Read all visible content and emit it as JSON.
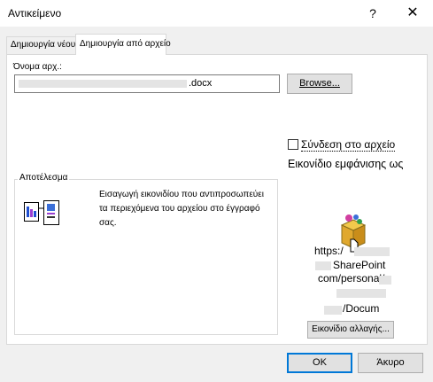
{
  "window": {
    "title": "Αντικείμενο",
    "help_glyph": "?",
    "close_glyph": "✕"
  },
  "tabs": [
    {
      "label": "Δημιουργία νέου",
      "active": false
    },
    {
      "label": "Δημιουργία από αρχείο",
      "active": true
    }
  ],
  "file": {
    "label": "Όνομα αρχ.:",
    "value_suffix": ".docx",
    "browse_label": "Browse..."
  },
  "link": {
    "label": "Σύνδεση στο αρχείο",
    "checked": false
  },
  "display_as_icon": {
    "label": "Εικονίδιο εμφάνισης ως"
  },
  "result": {
    "legend": "Αποτέλεσμα",
    "text": "Εισαγωγή εικονιδίου που αντιπροσωπεύει τα περιεχόμενα του αρχείου στο έγγραφό σας."
  },
  "icon_preview": {
    "line1": "https:/",
    "line2": "SharePoint",
    "line3": "com/personal/",
    "line4": "/Docum",
    "change_icon_label": "Εικονίδιο αλλαγής..."
  },
  "buttons": {
    "ok": "OK",
    "cancel": "Άκυρο"
  }
}
